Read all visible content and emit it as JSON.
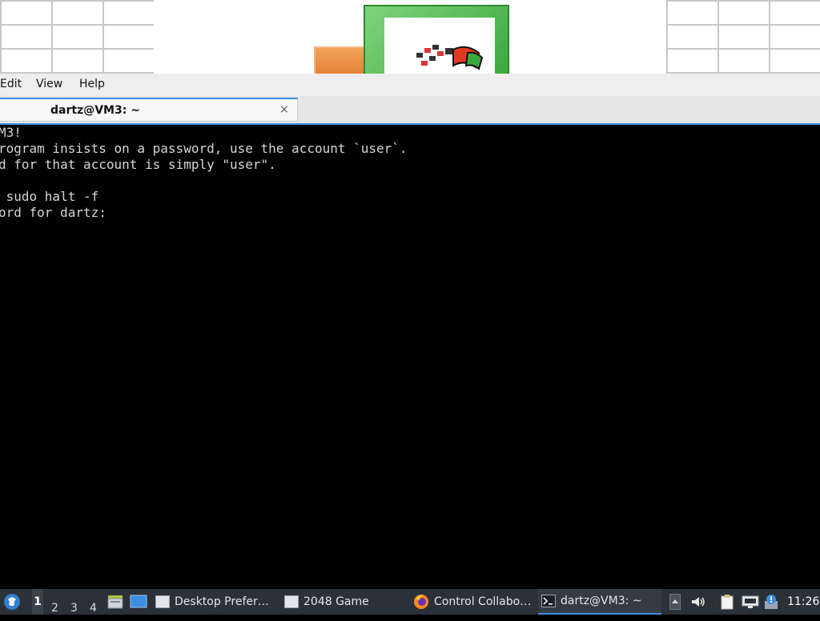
{
  "menubar": {
    "items": [
      "Edit",
      "View",
      "Help"
    ]
  },
  "tab": {
    "title": "dartz@VM3: ~",
    "close_glyph": "×"
  },
  "terminal": {
    "lines": [
      "M3!",
      "rogram insists on a password, use the account `user`.",
      "d for that account is simply \"user\".",
      "",
      " sudo halt -f",
      "ord for dartz:"
    ]
  },
  "taskbar": {
    "workspaces": [
      "1",
      "2",
      "3",
      "4"
    ],
    "active_workspace": "1",
    "tasks": [
      {
        "label": "Desktop Prefer…",
        "icon": "window-icon"
      },
      {
        "label": "2048 Game",
        "icon": "window-icon"
      },
      {
        "label": "Control Collabo…",
        "icon": "firefox-icon"
      },
      {
        "label": "dartz@VM3: ~",
        "icon": "terminal-icon"
      }
    ],
    "clock": "11:26"
  },
  "colors": {
    "accent": "#3d8ee0",
    "taskbar_bg": "#2b3138",
    "terminal_bg": "#000000",
    "terminal_fg": "#d6d6d6"
  }
}
